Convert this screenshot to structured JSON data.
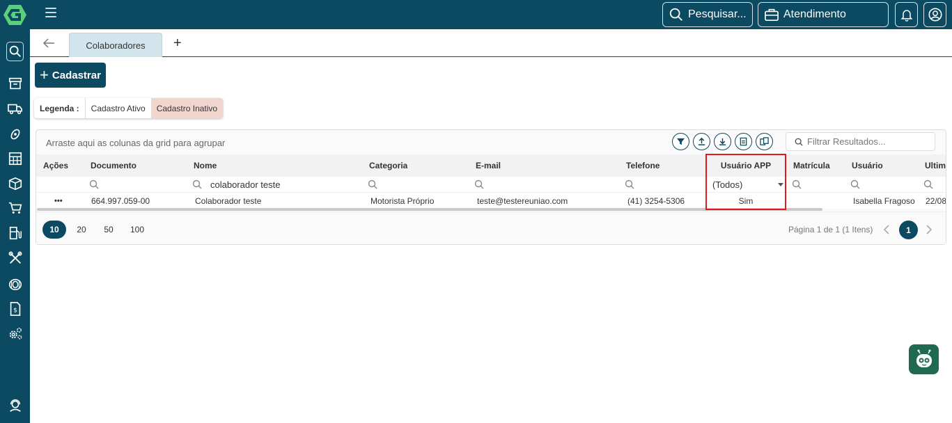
{
  "topbar": {
    "search_label": "Pesquisar...",
    "service_label": "Atendimento"
  },
  "tabs": {
    "active_tab": "Colaboradores",
    "add_tab": "+"
  },
  "actions": {
    "cadastrar_label": "Cadastrar"
  },
  "legend": {
    "label": "Legenda :",
    "items": [
      "Cadastro Ativo",
      "Cadastro Inativo"
    ],
    "inactive_color": "#f3d5d0"
  },
  "grid": {
    "group_hint": "Arraste aqui as colunas da grid para agrupar",
    "filter_placeholder": "Filtrar Resultados...",
    "columns": [
      "Ações",
      "Documento",
      "Nome",
      "Categoria",
      "E-mail",
      "Telefone",
      "Usuário APP",
      "Matrícula",
      "Usuário",
      "Ultim"
    ],
    "filters": {
      "nome": "colaborador teste",
      "usuario_app": "(Todos)"
    },
    "rows": [
      {
        "acoes": "•••",
        "documento": "664.997.059-00",
        "nome": "Colaborador teste",
        "categoria": "Motorista Próprio",
        "email": "teste@testereuniao.com",
        "telefone": "(41) 3254-5306",
        "usuario_app": "Sim",
        "matricula": "",
        "usuario": "Isabella Fragoso",
        "ultima": "22/08"
      }
    ],
    "page_sizes": [
      "10",
      "20",
      "50",
      "100"
    ],
    "active_page_size": "10",
    "page_info": "Página 1 de 1 (1 Itens)",
    "current_page": "1"
  },
  "colors": {
    "brand": "#0b4a60",
    "highlight": "#e01b1b",
    "bot": "#1f6a4f"
  }
}
